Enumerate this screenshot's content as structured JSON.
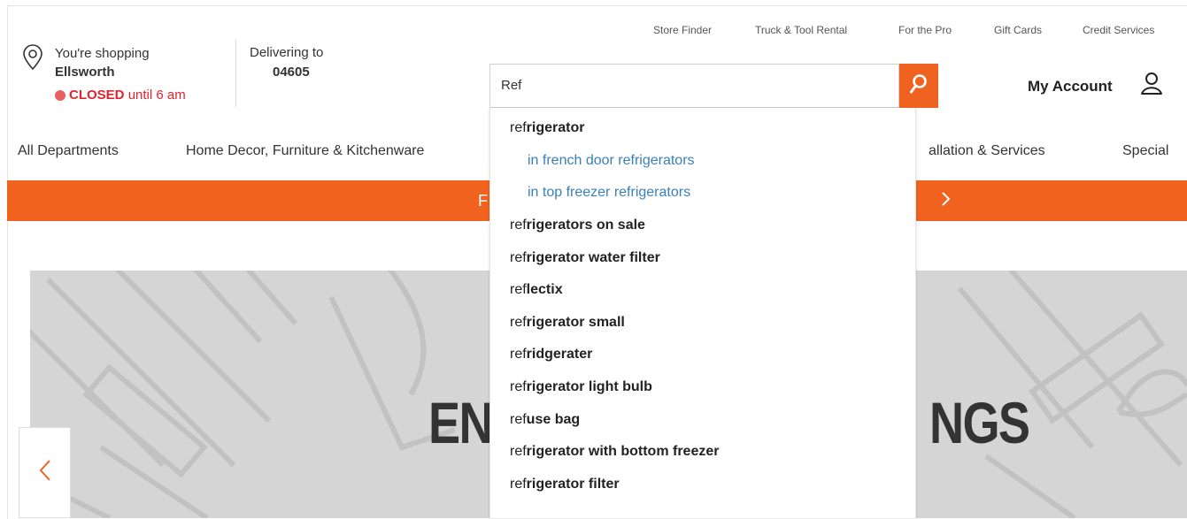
{
  "utility_links": [
    "Store Finder",
    "Truck & Tool Rental",
    "For the Pro",
    "Gift Cards",
    "Credit Services"
  ],
  "store": {
    "label": "You're shopping",
    "name": "Ellsworth",
    "status": "CLOSED",
    "status_detail": "until 6 am"
  },
  "delivery": {
    "label": "Delivering to",
    "zip": "04605"
  },
  "search": {
    "value": "Ref"
  },
  "account": {
    "label": "My Account"
  },
  "nav": [
    "All Departments",
    "Home Decor, Furniture & Kitchenware",
    "allation & Services",
    "Special"
  ],
  "promo": {
    "left_text": "F"
  },
  "hero": {
    "left_text": "EN",
    "right_text": "NGS"
  },
  "suggestions": [
    {
      "typed": "ref",
      "rest": "rigerator",
      "type": "term"
    },
    {
      "typed": "",
      "rest": "in french door refrigerators",
      "type": "sub"
    },
    {
      "typed": "",
      "rest": "in top freezer refrigerators",
      "type": "sub"
    },
    {
      "typed": "ref",
      "rest": "rigerators on sale",
      "type": "term"
    },
    {
      "typed": "ref",
      "rest": "rigerator water filter",
      "type": "term"
    },
    {
      "typed": "ref",
      "rest": "lectix",
      "type": "term"
    },
    {
      "typed": "ref",
      "rest": "rigerator small",
      "type": "term"
    },
    {
      "typed": "ref",
      "rest": "ridgerater",
      "type": "term"
    },
    {
      "typed": "ref",
      "rest": "rigerator light bulb",
      "type": "term"
    },
    {
      "typed": "ref",
      "rest": "use bag",
      "type": "term"
    },
    {
      "typed": "ref",
      "rest": "rigerator with bottom freezer",
      "type": "term"
    },
    {
      "typed": "ref",
      "rest": "rigerator filter",
      "type": "term"
    }
  ],
  "colors": {
    "brand_orange": "#f0621f",
    "closed_red": "#e3222f",
    "sub_link_blue": "#3a80b8"
  },
  "icons": [
    "location-pin-icon",
    "search-icon",
    "user-icon",
    "chevron-left-icon",
    "chevron-right-icon"
  ]
}
